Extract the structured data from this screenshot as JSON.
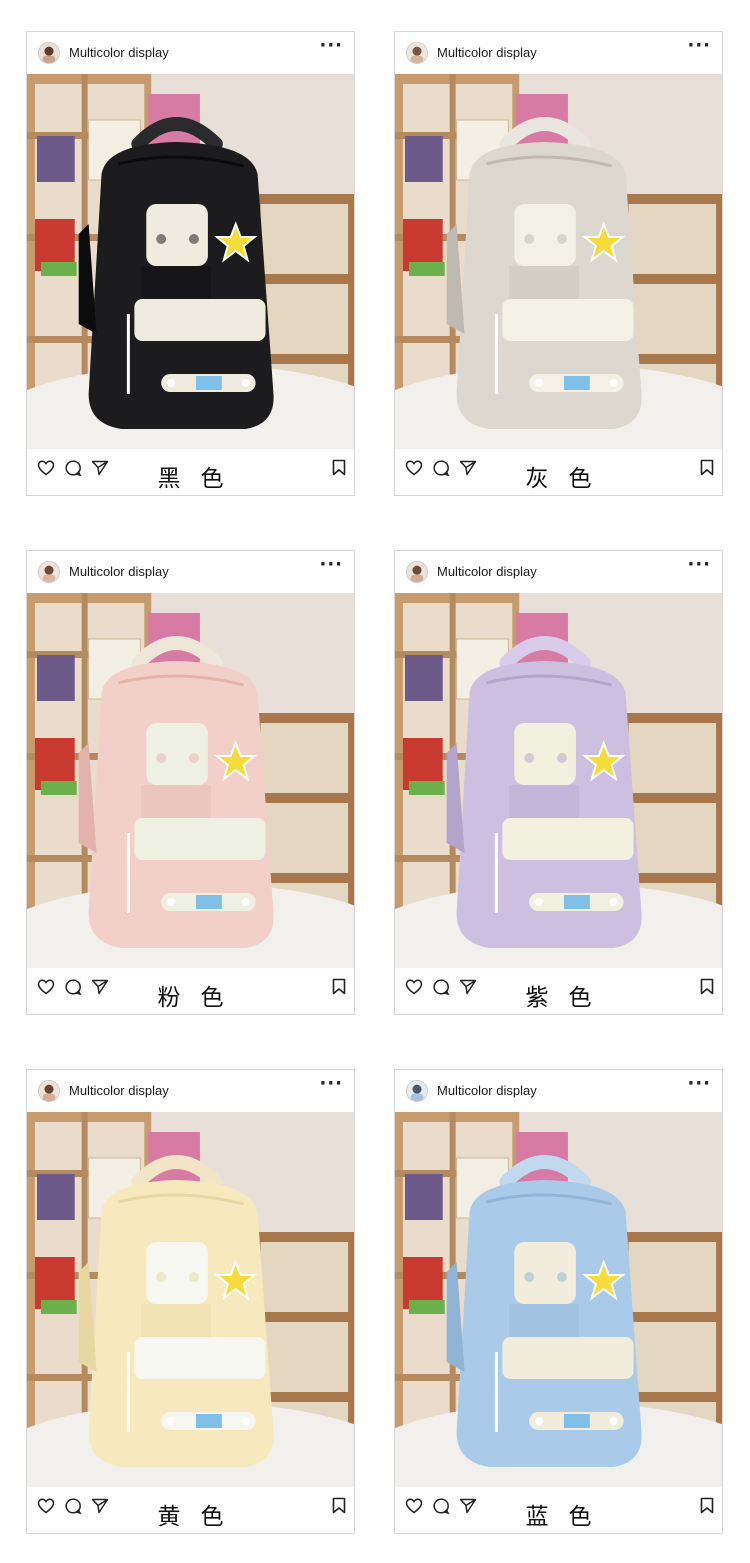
{
  "posts": [
    {
      "account": "Multicolor display",
      "more": "···",
      "color_name": "黑色",
      "icons": [
        "heart-icon",
        "comment-icon",
        "share-icon",
        "bookmark-icon"
      ],
      "bag": {
        "body": "#1c1c1e",
        "shade": "#0c0c0d",
        "accent": "#efecdf",
        "handle": "#2a2a2c"
      }
    },
    {
      "account": "Multicolor display",
      "more": "···",
      "color_name": "灰色",
      "icons": [
        "heart-icon",
        "comment-icon",
        "share-icon",
        "bookmark-icon"
      ],
      "bag": {
        "body": "#dcd8d0",
        "shade": "#bfbab1",
        "accent": "#f3f1e6",
        "handle": "#e9e6df"
      }
    },
    {
      "account": "Multicolor display",
      "more": "···",
      "color_name": "粉色",
      "icons": [
        "heart-icon",
        "comment-icon",
        "share-icon",
        "bookmark-icon"
      ],
      "bag": {
        "body": "#f3cfc9",
        "shade": "#e3b3ab",
        "accent": "#eef1e2",
        "handle": "#efe6da"
      }
    },
    {
      "account": "Multicolor display",
      "more": "···",
      "color_name": "紫色",
      "icons": [
        "heart-icon",
        "comment-icon",
        "share-icon",
        "bookmark-icon"
      ],
      "bag": {
        "body": "#cdbfe0",
        "shade": "#b3a4cc",
        "accent": "#f2f1e0",
        "handle": "#d8ccea"
      }
    },
    {
      "account": "Multicolor display",
      "more": "···",
      "color_name": "黄色",
      "icons": [
        "heart-icon",
        "comment-icon",
        "share-icon",
        "bookmark-icon"
      ],
      "bag": {
        "body": "#f6e9bd",
        "shade": "#e7d7a2",
        "accent": "#f7f7f1",
        "handle": "#f1e5c5"
      }
    },
    {
      "account": "Multicolor display",
      "more": "···",
      "color_name": "蓝色",
      "icons": [
        "heart-icon",
        "comment-icon",
        "share-icon",
        "bookmark-icon"
      ],
      "bag": {
        "body": "#a9cbe9",
        "shade": "#8fb4d6",
        "accent": "#f1ecdc",
        "handle": "#c0d9ef"
      }
    }
  ]
}
